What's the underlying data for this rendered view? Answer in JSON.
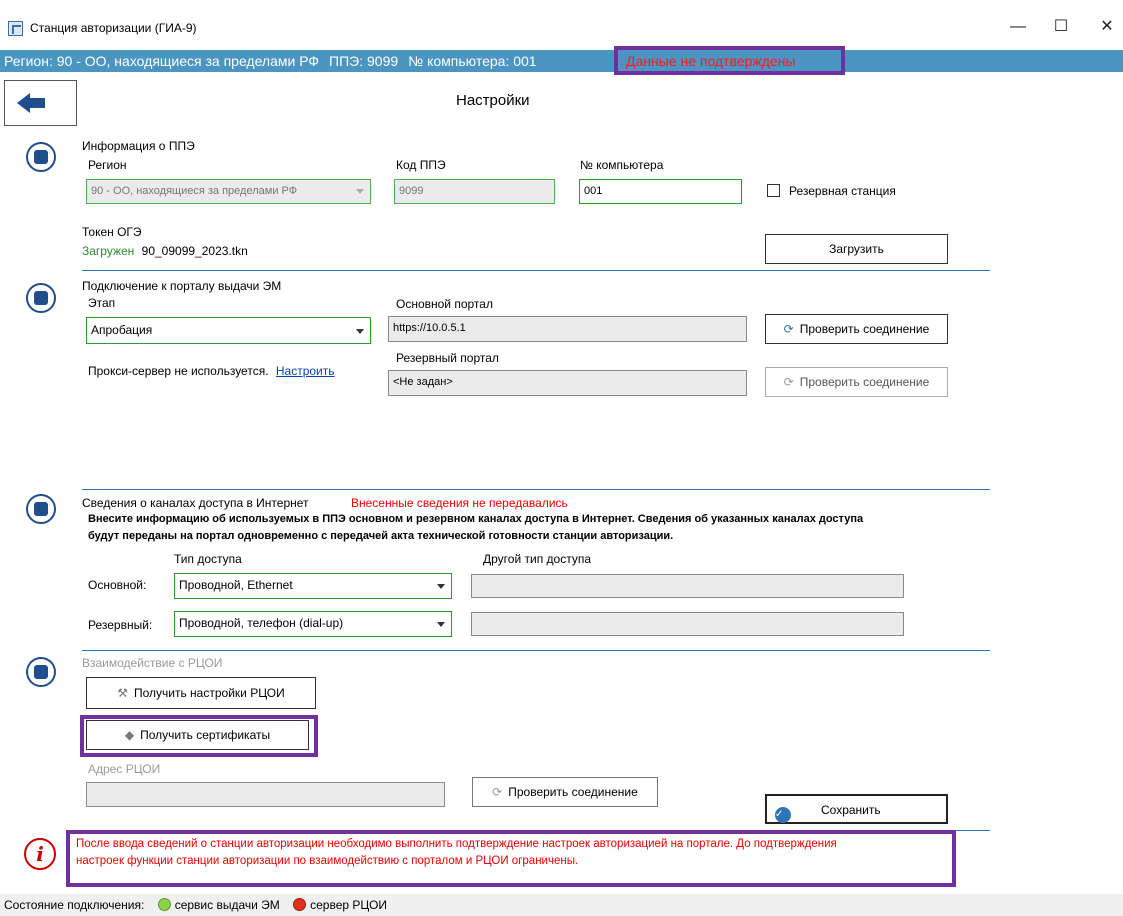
{
  "window": {
    "title": "Станция авторизации (ГИА-9)",
    "minimize": "—",
    "maximize": "☐",
    "close": "✕"
  },
  "infobar": {
    "region": "Регион: 90 - ОО, находящиеся за пределами РФ",
    "ppe": "ППЭ: 9099",
    "computer": "№ компьютера: 001",
    "status": "Данные не подтверждены"
  },
  "page": {
    "title": "Настройки"
  },
  "ppe_info": {
    "section_title": "Информация о ППЭ",
    "region_label": "Регион",
    "region_value": "90 - ОО, находящиеся за пределами РФ",
    "code_label": "Код ППЭ",
    "code_value": "9099",
    "computer_label": "№ компьютера",
    "computer_value": "001",
    "reserve_label": "Резервная станция",
    "token_label": "Токен ОГЭ",
    "token_status": "Загружен",
    "token_file": "90_09099_2023.tkn",
    "load_button": "Загрузить"
  },
  "portal": {
    "section_title": "Подключение к порталу выдачи ЭМ",
    "stage_label": "Этап",
    "stage_value": "Апробация",
    "main_portal_label": "Основной портал",
    "main_portal_value": "https://10.0.5.1",
    "check_button": "Проверить соединение",
    "reserve_portal_label": "Резервный портал",
    "reserve_portal_value": "<Не задан>",
    "check_button_2": "Проверить соединение",
    "proxy_text": "Прокси-сервер не используется.",
    "proxy_link": "Настроить"
  },
  "channels": {
    "section_title": "Сведения о каналах доступа в Интернет",
    "warning": "Внесенные сведения не передавались",
    "description_1": "Внесите информацию  об используемых в ППЭ основном и резервном каналах доступа в Интернет. Сведения об указанных каналах доступа",
    "description_2": "будут переданы на портал одновременно с передачей акта технической готовности станции авторизации.",
    "type_header": "Тип доступа",
    "other_header": "Другой тип доступа",
    "main_label": "Основной:",
    "main_value": "Проводной, Ethernet",
    "reserve_label": "Резервный:",
    "reserve_value": "Проводной, телефон (dial-up)"
  },
  "rcoi": {
    "section_title": "Взаимодействие с РЦОИ",
    "get_settings_button": "Получить настройки РЦОИ",
    "get_certs_button": "Получить сертификаты",
    "address_label": "Адрес РЦОИ",
    "check_button": "Проверить соединение",
    "save_button": "Сохранить"
  },
  "notice": {
    "line_1": "После ввода сведений о станции авторизации необходимо выполнить подтверждение настроек авторизацией на портале. До подтверждения",
    "line_2": "настроек функции станции авторизации по взаимодействию с порталом и РЦОИ ограничены."
  },
  "status_bar": {
    "label": "Состояние подключения:",
    "em_service": "сервис выдачи ЭМ",
    "rcoi_server": "сервер РЦОИ",
    "em_color": "#8fd14f",
    "rcoi_color": "#e03020"
  }
}
